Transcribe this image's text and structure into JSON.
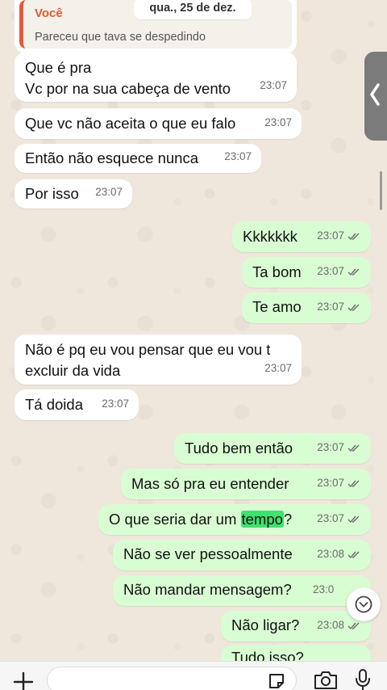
{
  "date_chip": "qua., 25 de dez.",
  "quoted": {
    "author": "Você",
    "text": "Pareceu que tava se despedindo"
  },
  "messages": [
    {
      "dir": "in",
      "lines": [
        "Que é pra",
        "Vc por na sua cabeça de vento"
      ],
      "time": "23:07"
    },
    {
      "dir": "in",
      "lines": [
        "Que vc não aceita o que eu falo"
      ],
      "time": "23:07"
    },
    {
      "dir": "in",
      "lines": [
        "Então não esquece nunca"
      ],
      "time": "23:07"
    },
    {
      "dir": "in",
      "lines": [
        "Por isso"
      ],
      "time": "23:07"
    },
    {
      "dir": "out",
      "lines": [
        "Kkkkkkk"
      ],
      "time": "23:07",
      "status": "read"
    },
    {
      "dir": "out",
      "lines": [
        "Ta bom"
      ],
      "time": "23:07",
      "status": "read"
    },
    {
      "dir": "out",
      "lines": [
        "Te amo"
      ],
      "time": "23:07",
      "status": "read"
    },
    {
      "dir": "in",
      "lines": [
        "Não é pq eu vou pensar que eu vou t",
        "excluir da vida"
      ],
      "time": "23:07"
    },
    {
      "dir": "in",
      "lines": [
        "Tá doida"
      ],
      "time": "23:07"
    },
    {
      "dir": "out",
      "lines": [
        "Tudo bem então"
      ],
      "time": "23:07",
      "status": "read"
    },
    {
      "dir": "out",
      "lines": [
        "Mas só pra eu entender"
      ],
      "time": "23:07",
      "status": "read"
    },
    {
      "dir": "out",
      "pre": "O que seria dar um ",
      "highlight": "tempo",
      "post": "?",
      "time": "23:07",
      "status": "read"
    },
    {
      "dir": "out",
      "lines": [
        "Não se ver pessoalmente"
      ],
      "time": "23:08",
      "status": "read"
    },
    {
      "dir": "out",
      "lines": [
        "Não mandar mensagem?"
      ],
      "time": "23:0"
    },
    {
      "dir": "out",
      "lines": [
        "Não ligar?"
      ],
      "time": "23:08",
      "status": "read"
    },
    {
      "dir": "out",
      "lines": [
        "Tudo isso?"
      ],
      "time": ""
    }
  ],
  "colors": {
    "incoming_bubble": "#ffffff",
    "outgoing_bubble": "#d9fdd3",
    "read_ticks": "#6b6b6b",
    "highlight": "#3ee26d",
    "quote_author": "#e05a36"
  },
  "icons": {
    "attach": "plus-icon",
    "sticker": "sticker-icon",
    "camera": "camera-icon",
    "mic": "microphone-icon",
    "scroll_down": "chevron-down-icon",
    "side_panel": "chevron-left-icon"
  }
}
